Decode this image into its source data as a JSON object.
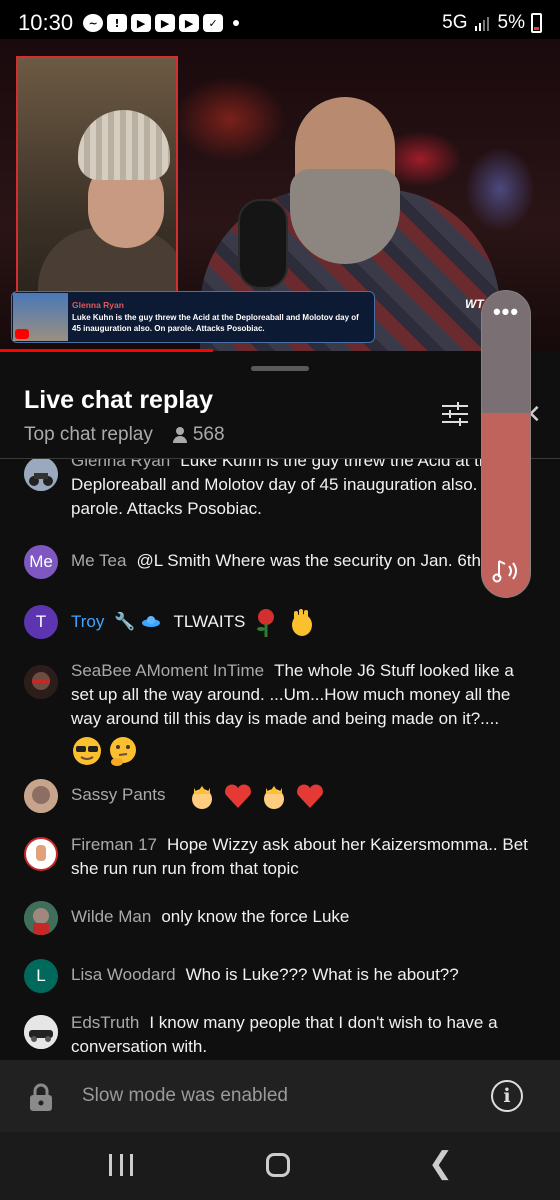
{
  "status_bar": {
    "time": "10:30",
    "notification_icons": [
      "messenger-icon",
      "alert-icon",
      "youtube-icon",
      "youtube-icon",
      "youtube-icon",
      "calendar-icon"
    ],
    "network": "5G",
    "battery": "5%"
  },
  "video": {
    "lower_third_name": "Glenna Ryan",
    "lower_third_message": "Luke Kuhn is the guy threw the Acid at the Deploreaball and Molotov day of 45 inauguration also. On parole. Attacks Posobiac.",
    "brand_text": "WT",
    "progress": 0.38
  },
  "chat": {
    "title": "Live chat replay",
    "subtitle": "Top chat replay",
    "viewer_count": "568"
  },
  "messages": [
    {
      "author": "Glenna Ryan",
      "text": "Luke Kuhn is the guy threw the Acid at the Deploreaball and Molotov day of 45 inauguration also. On parole. Attacks Posobiac.",
      "avatar": "motorcycle"
    },
    {
      "author": "Me Tea",
      "text": "@L Smith Where was the security on Jan. 6th",
      "avatar_initials": "Me",
      "avatar_color": "#7e57c2"
    },
    {
      "author": "Troy",
      "text": "TLWAITS",
      "avatar_initials": "T",
      "avatar_color": "#5e35b1",
      "emojis": [
        "rose-emoji",
        "waving-hand-emoji"
      ]
    },
    {
      "author": "SeaBee AMoment InTime",
      "text": "The whole J6 Stuff looked like a set up all the way around. ...Um...How much money all the way around till this day is made and being made on it?....",
      "avatar": "photo",
      "emojis": [
        "sunglasses-face-emoji",
        "thinking-face-emoji"
      ]
    },
    {
      "author": "Sassy Pants",
      "text": "",
      "avatar": "photo",
      "emojis": [
        "princess-emoji",
        "red-heart-emoji",
        "princess-emoji",
        "red-heart-emoji"
      ]
    },
    {
      "author": "Fireman 17",
      "text": "Hope Wizzy ask about her Kaizersmomma.. Bet she run run run from that topic",
      "avatar": "hand"
    },
    {
      "author": "Wilde Man",
      "text": "only know the force Luke",
      "avatar": "photo"
    },
    {
      "author": "Lisa Woodard",
      "text": "Who is Luke??? What is he about??",
      "avatar_initials": "L",
      "avatar_color": "#00695c"
    },
    {
      "author": "EdsTruth",
      "text": "I know many people that I don't wish to have a conversation with.",
      "avatar": "car"
    }
  ],
  "volume": {
    "level": 0.6
  },
  "slow_mode": {
    "text": "Slow mode was enabled"
  },
  "colors": {
    "member_blue": "#3ea6ff",
    "progress_red": "#ff0000",
    "volume_fill": "#c0635d"
  }
}
